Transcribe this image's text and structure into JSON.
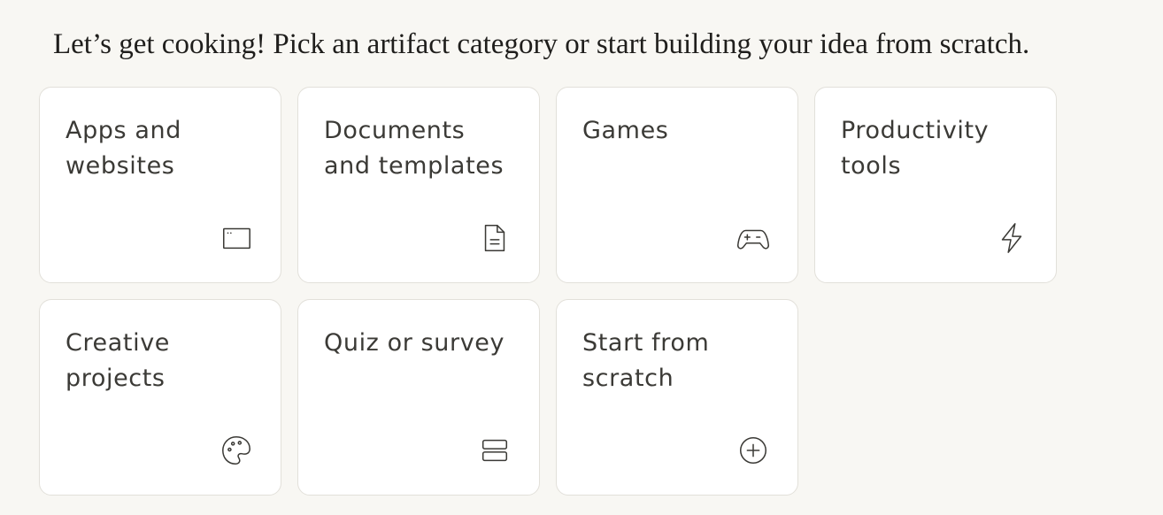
{
  "intro": "Let’s get cooking! Pick an artifact category or start building your idea from scratch.",
  "cards": [
    {
      "label": "Apps and websites",
      "icon": "app-window-icon"
    },
    {
      "label": "Documents and templates",
      "icon": "document-icon"
    },
    {
      "label": "Games",
      "icon": "gamepad-icon"
    },
    {
      "label": "Productivity tools",
      "icon": "lightning-icon"
    },
    {
      "label": "Creative projects",
      "icon": "palette-icon"
    },
    {
      "label": "Quiz or survey",
      "icon": "stacked-rows-icon"
    },
    {
      "label": "Start from scratch",
      "icon": "plus-circle-icon"
    }
  ],
  "colors": {
    "background": "#f8f7f3",
    "card": "#ffffff",
    "card_border": "#e2e0da",
    "text": "#3b3a36"
  }
}
